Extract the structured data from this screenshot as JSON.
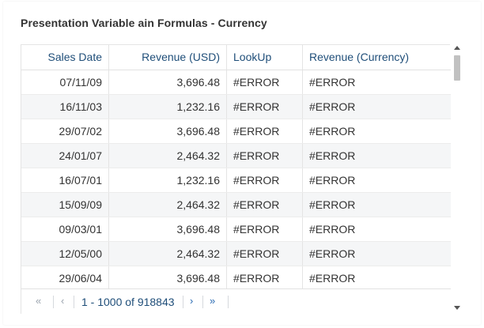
{
  "title": "Presentation Variable ain Formulas - Currency",
  "columns": [
    "Sales Date",
    "Revenue (USD)",
    "LookUp",
    "Revenue (Currency)"
  ],
  "rows": [
    [
      "07/11/09",
      "3,696.48",
      "#ERROR",
      "#ERROR"
    ],
    [
      "16/11/03",
      "1,232.16",
      "#ERROR",
      "#ERROR"
    ],
    [
      "29/07/02",
      "3,696.48",
      "#ERROR",
      "#ERROR"
    ],
    [
      "24/01/07",
      "2,464.32",
      "#ERROR",
      "#ERROR"
    ],
    [
      "16/07/01",
      "1,232.16",
      "#ERROR",
      "#ERROR"
    ],
    [
      "15/09/09",
      "2,464.32",
      "#ERROR",
      "#ERROR"
    ],
    [
      "09/03/01",
      "3,696.48",
      "#ERROR",
      "#ERROR"
    ],
    [
      "12/05/00",
      "2,464.32",
      "#ERROR",
      "#ERROR"
    ],
    [
      "29/06/04",
      "3,696.48",
      "#ERROR",
      "#ERROR"
    ]
  ],
  "pager": {
    "first": "«",
    "prev": "‹",
    "info": "1 - 1000 of 918843",
    "next": "›",
    "last": "»"
  }
}
